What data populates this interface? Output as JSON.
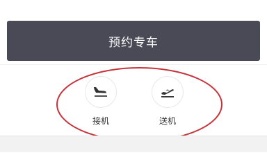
{
  "booking": {
    "button_label": "预约专车"
  },
  "services": [
    {
      "label": "接机",
      "icon": "plane-landing-icon"
    },
    {
      "label": "送机",
      "icon": "plane-takeoff-icon"
    }
  ],
  "colors": {
    "button_bg": "#4a4a57",
    "annotation": "#c8323a"
  }
}
